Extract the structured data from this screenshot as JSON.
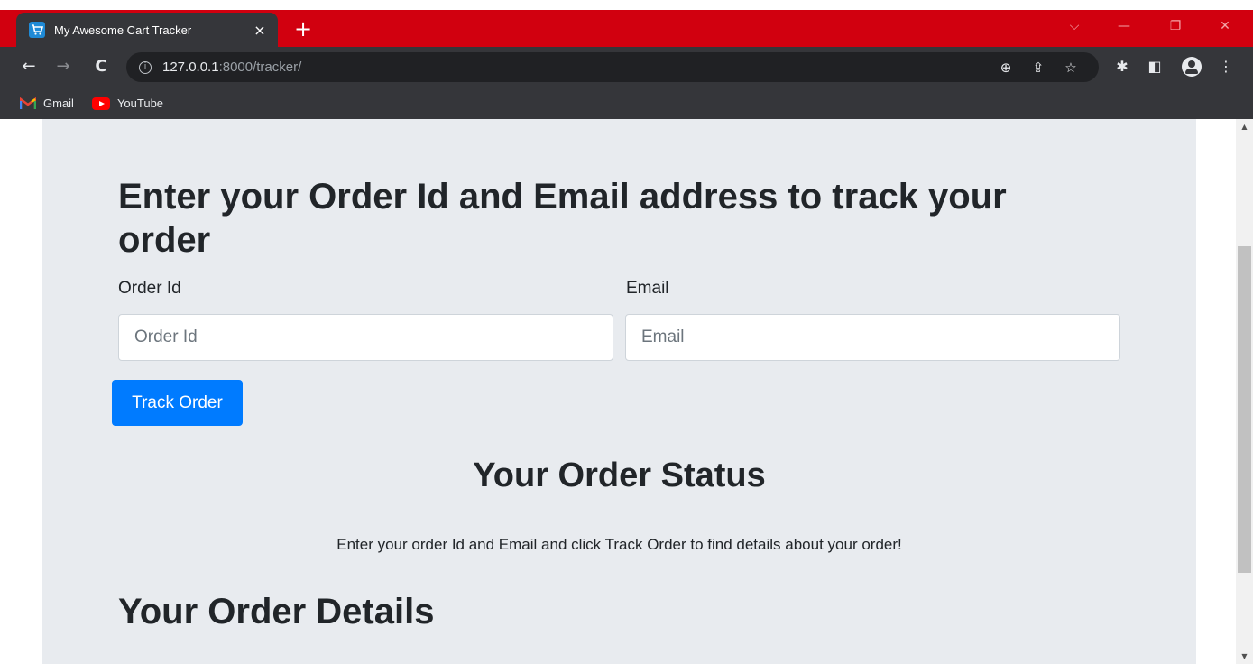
{
  "browser": {
    "tab_title": "My Awesome Cart Tracker",
    "tab_close": "×",
    "new_tab": "+",
    "url_host": "127.0.0.1",
    "url_rest": ":8000/tracker/",
    "nav": {
      "back": "←",
      "forward": "→",
      "reload": "C"
    },
    "window_controls": {
      "tab_search": "⌵",
      "minimize": "—",
      "restore": "❐",
      "close": "✕"
    },
    "toolbar_icons": {
      "zoom": "⊕",
      "share": "⇪",
      "bookmark_star": "☆",
      "extensions": "✱",
      "side_panel": "◧",
      "menu": "⋮"
    },
    "bookmarks": [
      {
        "label": "Gmail",
        "icon": "gmail-icon"
      },
      {
        "label": "YouTube",
        "icon": "youtube-icon"
      }
    ]
  },
  "page": {
    "title": "Enter your Order Id and Email address to track your order",
    "order_id": {
      "label": "Order Id",
      "placeholder": "Order Id",
      "value": ""
    },
    "email": {
      "label": "Email",
      "placeholder": "Email",
      "value": ""
    },
    "track_button": "Track Order",
    "status_heading": "Your Order Status",
    "status_text": "Enter your order Id and Email and click Track Order to find details about your order!",
    "details_heading": "Your Order Details"
  },
  "scrollbar": {
    "up": "▲",
    "down": "▼"
  },
  "colors": {
    "titlebar": "#d1000f",
    "toolbar": "#35363a",
    "page_bg": "#e8ebef",
    "button": "#007bff"
  }
}
